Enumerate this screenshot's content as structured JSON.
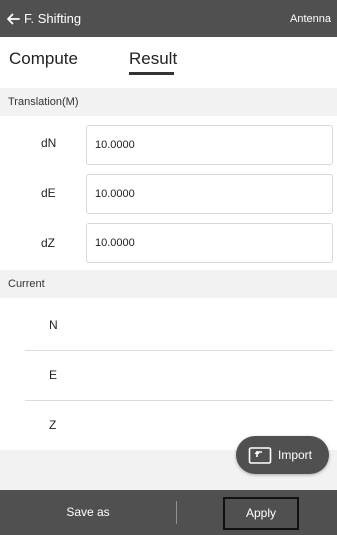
{
  "header": {
    "title": "F. Shifting",
    "right_action": "Antenna"
  },
  "tabs": [
    {
      "label": "Compute",
      "active": false
    },
    {
      "label": "Result",
      "active": true
    }
  ],
  "translation": {
    "header": "Translation(M)",
    "rows": [
      {
        "label": "dN",
        "value": "10.0000"
      },
      {
        "label": "dE",
        "value": "10.0000"
      },
      {
        "label": "dZ",
        "value": "10.0000"
      }
    ]
  },
  "current": {
    "header": "Current",
    "rows": [
      {
        "label": "N",
        "value": ""
      },
      {
        "label": "E",
        "value": ""
      },
      {
        "label": "Z",
        "value": ""
      }
    ]
  },
  "import_button": {
    "label": "Import",
    "icon": "import-icon"
  },
  "footer": {
    "save_as_label": "Save as",
    "apply_label": "Apply"
  },
  "colors": {
    "bar_bg": "#505050",
    "page_bg": "#f2f2f2",
    "text": "#222222"
  }
}
